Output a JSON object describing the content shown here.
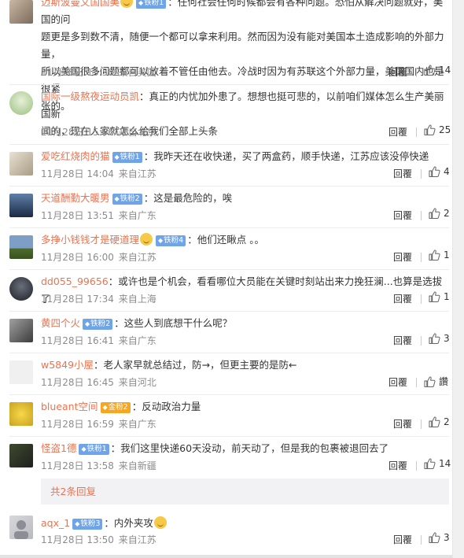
{
  "comments": [
    {
      "username": "迈斯波曼文国国美",
      "badge": "铁粉1",
      "badge_color": "blue",
      "has_emoji": true,
      "lines": [
        "：任何社会任何时候都会有各种问题。恐怕从解决问题就好，美国的问",
        "题更是多到数不清，随便一个都可以拿来利用。然而因为没有能对美国本土造成影响的外部力量，",
        "所以美国很多问题都可以放着不管任由他去。冷战时因为有苏联这个外部力量，美国国内也是很紧",
        "张的。"
      ],
      "date": "11月28日 13:58",
      "source": "来自美国",
      "reply_label": "回覆",
      "likes": "14"
    },
    {
      "username": "国际一级熬夜运动员凯",
      "badge": "",
      "has_emoji": false,
      "lines": [
        "：真正的内忧加外患了。想想也挺可悲的，以前咱们媒体怎么生产美丽国新",
        "闻的，现在人家就怎么给我们全部上头条"
      ],
      "date": "11月28日 15:06",
      "source": "来自北京",
      "reply_label": "回覆",
      "likes": "25"
    },
    {
      "username": "爱吃红烧肉的猫",
      "badge": "铁粉1",
      "badge_color": "blue",
      "has_emoji": false,
      "lines": [
        "：我昨天还在收快递，买了两盒药，顺手快递，江苏应该没停快递"
      ],
      "date": "11月28日 14:04",
      "source": "来自江苏",
      "reply_label": "回覆",
      "likes": "4"
    },
    {
      "username": "天道酬勤大暖男",
      "badge": "铁粉2",
      "badge_color": "blue",
      "has_emoji": false,
      "lines": [
        "：这是最危险的，唉"
      ],
      "date": "11月28日 13:51",
      "source": "来自广东",
      "reply_label": "回覆",
      "likes": "2"
    },
    {
      "username": "多挣小钱钱才是硬道理",
      "badge": "铁粉4",
      "badge_color": "blue",
      "has_emoji": true,
      "lines": [
        "：他们还瞅点 。。"
      ],
      "date": "11月28日 16:00",
      "source": "来自江苏",
      "reply_label": "回覆",
      "likes": "1"
    },
    {
      "username": "dd055_99656",
      "badge": "",
      "has_emoji": false,
      "lines": [
        "：或许也是个机会，看看哪位大员能在关键时刻站出来力挽狂澜...也算是选拔了"
      ],
      "date": "11月28日 17:34",
      "source": "来自上海",
      "reply_label": "回覆",
      "likes": "1"
    },
    {
      "username": "黄四个火",
      "badge": "铁粉2",
      "badge_color": "blue",
      "has_emoji": false,
      "lines": [
        "：这些人到底想干什么呢？"
      ],
      "date": "11月28日 16:41",
      "source": "来自广东",
      "reply_label": "回覆",
      "likes": "3"
    },
    {
      "username": "w5849小屋",
      "badge": "",
      "has_emoji": false,
      "lines": [
        "：老人家早就总结过，防→，但更主要的是防←"
      ],
      "date": "11月28日 16:45",
      "source": "来自河北",
      "reply_label": "回覆",
      "likes": "讚"
    },
    {
      "username": "blueant空间",
      "badge": "金粉2",
      "badge_color": "gold",
      "has_emoji": false,
      "lines": [
        "：反动政治力量"
      ],
      "date": "11月28日 16:59",
      "source": "来自广东",
      "reply_label": "回覆",
      "likes": "2"
    },
    {
      "username": "怪盗1德",
      "badge": "铁粉1",
      "badge_color": "blue",
      "has_emoji": false,
      "lines": [
        "：我们这里快递60天没动，前天动了，但是我的包裹被退回去了"
      ],
      "date": "11月28日 13:58",
      "source": "来自新疆",
      "reply_label": "回覆",
      "likes": "14"
    }
  ],
  "more_replies_label": "共2条回复",
  "reply": {
    "username": "aqx_1",
    "badge": "铁粉3",
    "badge_color": "blue",
    "text": "：内外夹攻",
    "date": "11月28日 13:50",
    "source": "来自江苏",
    "reply_label": "回覆",
    "likes": "3"
  },
  "colors": {
    "username": "#eb7350",
    "meta": "#8c8c8c",
    "badge_blue": "#6fa5e8",
    "badge_gold": "#f5a623"
  },
  "icons": {
    "like": "thumbs-up-icon",
    "badge": "diamond-icon"
  }
}
